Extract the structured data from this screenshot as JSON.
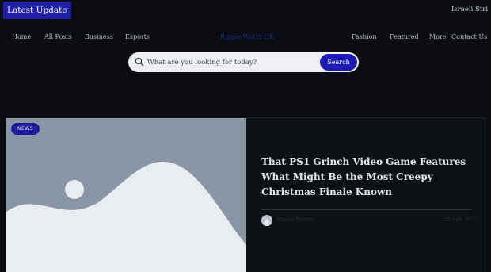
{
  "topbar": {
    "latest_label": "Latest Update",
    "ticker_text": "Israeli Stri"
  },
  "nav": {
    "home": "Home",
    "all_posts": "All Posts",
    "business": "Business",
    "esports": "Esports",
    "brand": "Ripple World UK",
    "fashion": "Fashion",
    "featured": "Featured",
    "more": "More",
    "contact": "Contact Us"
  },
  "search": {
    "placeholder": "What are you looking for today?",
    "button_label": "Search"
  },
  "featured_post": {
    "badge": "NEWS",
    "title": "That PS1 Grinch Video Game Features What Might Be the Most Creepy Christmas Finale Known",
    "author": "Ripple Writer",
    "date": "28 Feb 2025"
  },
  "colors": {
    "accent": "#1f1fa8",
    "background": "#0b0d12",
    "image_placeholder": "#8a96a6"
  }
}
